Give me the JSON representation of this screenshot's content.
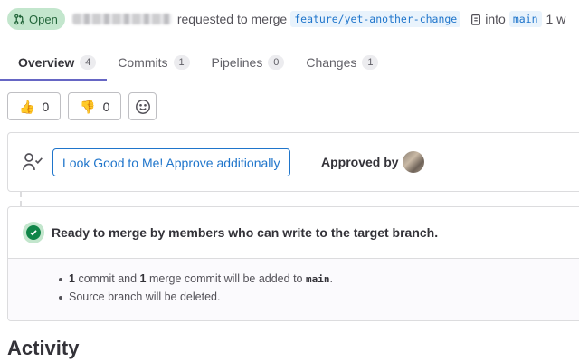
{
  "header": {
    "state_label": "Open",
    "requested_text": "requested to merge",
    "source_branch": "feature/yet-another-change",
    "into_text": "into",
    "target_branch": "main",
    "trailing_text": "1 w"
  },
  "tabs": [
    {
      "label": "Overview",
      "count": "4"
    },
    {
      "label": "Commits",
      "count": "1"
    },
    {
      "label": "Pipelines",
      "count": "0"
    },
    {
      "label": "Changes",
      "count": "1"
    }
  ],
  "reactions": {
    "thumbs_up_count": "0",
    "thumbs_down_count": "0"
  },
  "approvals": {
    "approve_button": "Look Good to Me! Approve additionally",
    "approved_by_label": "Approved by"
  },
  "merge": {
    "title": "Ready to merge by members who can write to the target branch.",
    "commit_count": "1",
    "commit_text": "commit and",
    "merge_commit_count": "1",
    "merge_commit_text": "merge commit will be added to",
    "target_branch": "main",
    "period": ".",
    "source_deleted": "Source branch will be deleted."
  },
  "activity_title": "Activity",
  "colors": {
    "accent": "#1f75cb",
    "success": "#108548",
    "tab_indicator": "#6666c4"
  }
}
